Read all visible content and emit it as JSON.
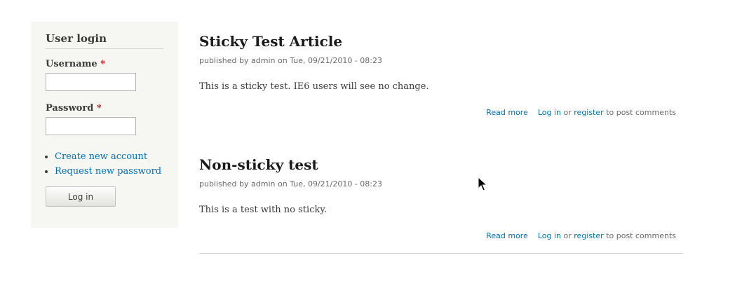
{
  "login_block": {
    "title": "User login",
    "username_label": "Username",
    "password_label": "Password",
    "required_marker": "*",
    "username_value": "",
    "password_value": "",
    "links": [
      "Create new account",
      "Request new password"
    ],
    "submit_label": "Log in"
  },
  "articles": [
    {
      "title": "Sticky Test Article",
      "meta_prefix": "published by",
      "author": "admin",
      "meta_date": "on Tue, 09/21/2010 - 08:23",
      "body": "This is a sticky test. IE6 users will see no change.",
      "read_more": "Read more",
      "login_link": "Log in",
      "or_text": "or",
      "register_link": "register",
      "post_comments_text": "to post comments"
    },
    {
      "title": "Non-sticky test",
      "meta_prefix": "published by",
      "author": "admin",
      "meta_date": "on Tue, 09/21/2010 - 08:23",
      "body": "This is a test with no sticky.",
      "read_more": "Read more",
      "login_link": "Log in",
      "or_text": "or",
      "register_link": "register",
      "post_comments_text": "to post comments"
    }
  ],
  "colors": {
    "link": "#0071b3",
    "sidebar_bg": "#f6f6f2",
    "required": "#cc2222",
    "meta_text": "#68696b"
  },
  "icons": {
    "cursor": "mouse-pointer-icon"
  }
}
